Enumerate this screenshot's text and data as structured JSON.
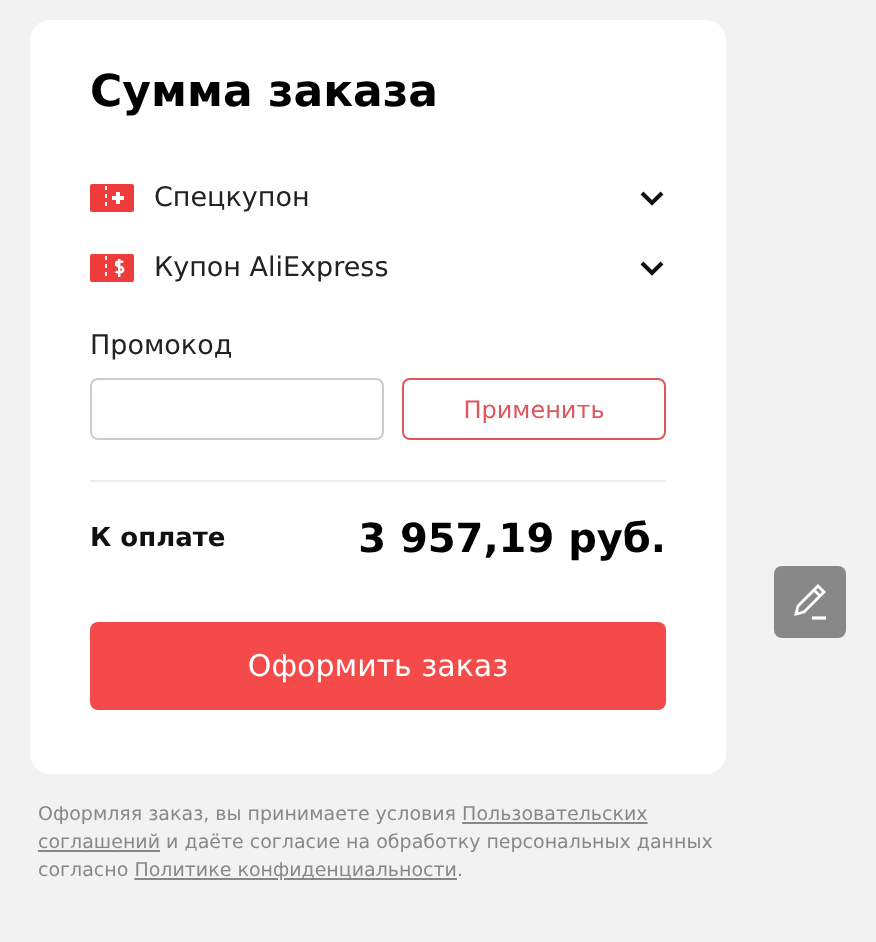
{
  "title": "Сумма заказа",
  "coupons": [
    {
      "kind": "special",
      "label": "Спецкупон",
      "expanded": false
    },
    {
      "kind": "store",
      "label": "Купон AliExpress",
      "expanded": false
    }
  ],
  "promo": {
    "label": "Промокод",
    "button": "Применить"
  },
  "total": {
    "label": "К оплате",
    "amount": "3 957,19 руб."
  },
  "checkout_button": "Оформить заказ",
  "legal_lines": [
    [
      {
        "kind": "text",
        "text": "Оформляя заказ, вы принимаете условия "
      },
      {
        "kind": "link",
        "text": "Пользовательских"
      }
    ],
    [
      {
        "kind": "link",
        "text": "соглашений"
      },
      {
        "kind": "text",
        "text": " и даёте согласие на обработку персональных данных"
      }
    ],
    [
      {
        "kind": "text",
        "text": "согласно "
      },
      {
        "kind": "link",
        "text": "Политике конфиденциальности"
      },
      {
        "kind": "text",
        "text": "."
      }
    ]
  ]
}
